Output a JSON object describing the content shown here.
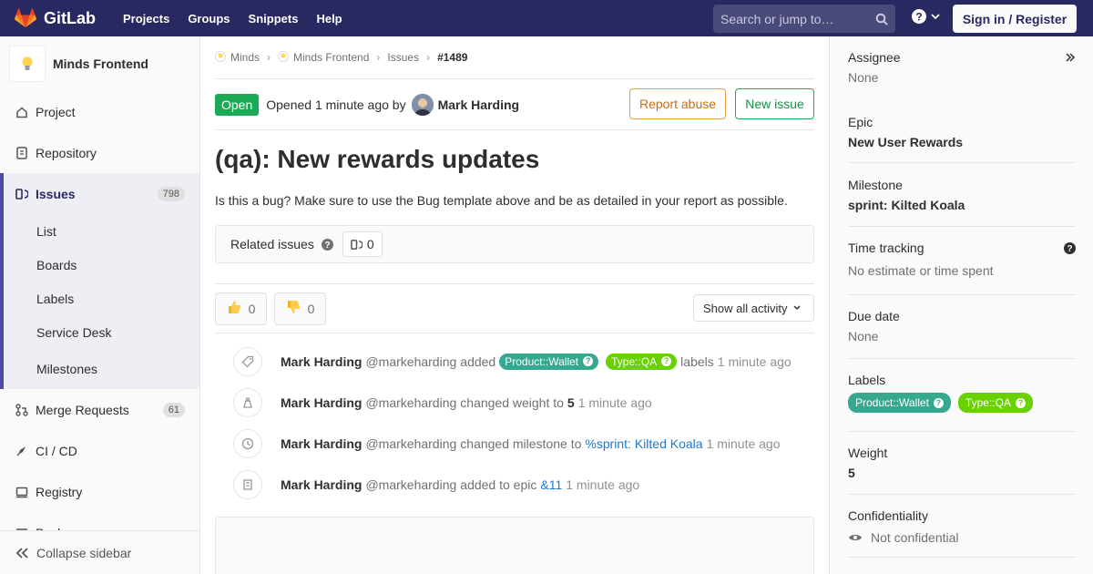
{
  "navbar": {
    "brand": "GitLab",
    "links": [
      "Projects",
      "Groups",
      "Snippets",
      "Help"
    ],
    "search_placeholder": "Search or jump to…",
    "signin": "Sign in / Register"
  },
  "sidebar": {
    "project_name": "Minds Frontend",
    "items_top": [
      {
        "label": "Project",
        "icon": "home-icon"
      },
      {
        "label": "Repository",
        "icon": "doc-icon"
      }
    ],
    "issues": {
      "label": "Issues",
      "count": "798"
    },
    "sub_items": [
      "List",
      "Boards",
      "Labels",
      "Service Desk",
      "Milestones"
    ],
    "items_bottom": [
      {
        "label": "Merge Requests",
        "count": "61"
      },
      {
        "label": "CI / CD"
      },
      {
        "label": "Registry"
      },
      {
        "label": "Packages"
      }
    ],
    "collapse": "Collapse sidebar"
  },
  "breadcrumb": [
    "Minds",
    "Minds Frontend",
    "Issues",
    "#1489"
  ],
  "issue": {
    "status": "Open",
    "opened_text": "Opened 1 minute ago by",
    "author": "Mark Harding",
    "report_abuse": "Report abuse",
    "new_issue": "New issue",
    "title": "(qa): New rewards updates",
    "description": "Is this a bug? Make sure to use the Bug template above and be as detailed in your report as possible.",
    "related_label": "Related issues",
    "related_count": "0",
    "thumbs_up": "0",
    "thumbs_down": "0",
    "activity_filter": "Show all activity"
  },
  "notes": {
    "n1": {
      "name": "Mark Harding",
      "handle": "@markeharding",
      "action": "added",
      "label1": "Product::Wallet",
      "label2": "Type::QA",
      "suffix": "labels",
      "time": "1 minute ago"
    },
    "n2": {
      "name": "Mark Harding",
      "handle": "@markeharding",
      "action": "changed weight to",
      "value": "5",
      "time": "1 minute ago"
    },
    "n3": {
      "name": "Mark Harding",
      "handle": "@markeharding",
      "action": "changed milestone to",
      "link": "%sprint: Kilted Koala",
      "time": "1 minute ago"
    },
    "n4": {
      "name": "Mark Harding",
      "handle": "@markeharding",
      "action": "added to epic",
      "link": "&11",
      "time": "1 minute ago"
    }
  },
  "right_sidebar": {
    "assignee_title": "Assignee",
    "assignee_value": "None",
    "epic_title": "Epic",
    "epic_value": "New User Rewards",
    "milestone_title": "Milestone",
    "milestone_value": "sprint: Kilted Koala",
    "time_title": "Time tracking",
    "time_value": "No estimate or time spent",
    "due_title": "Due date",
    "due_value": "None",
    "labels_title": "Labels",
    "label1": "Product::Wallet",
    "label2": "Type::QA",
    "weight_title": "Weight",
    "weight_value": "5",
    "conf_title": "Confidentiality",
    "conf_value": "Not confidential"
  },
  "colors": {
    "navbar": "#292961",
    "open": "#1aaa55",
    "label_wallet": "#36a88e",
    "label_qa": "#69d100"
  }
}
